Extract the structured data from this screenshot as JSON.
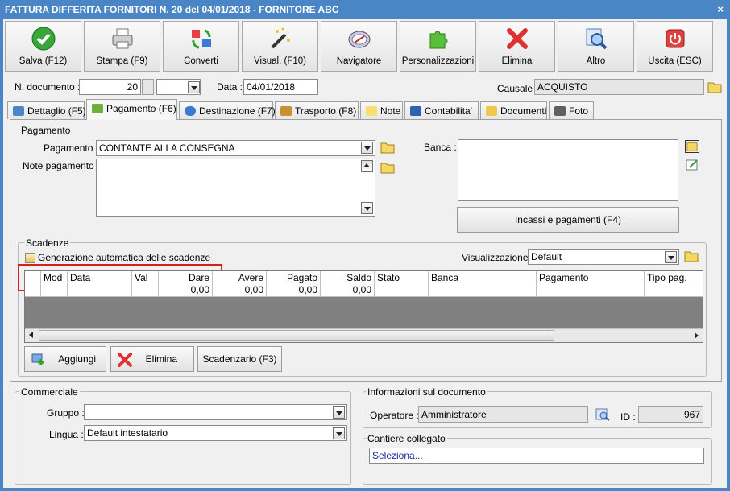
{
  "window": {
    "title": "FATTURA DIFFERITA FORNITORI N. 20 del 04/01/2018 - FORNITORE ABC",
    "close_glyph": "×"
  },
  "toolbar": [
    {
      "label": "Salva (F12)",
      "icon": "check-icon"
    },
    {
      "label": "Stampa (F9)",
      "icon": "printer-icon"
    },
    {
      "label": "Converti",
      "icon": "convert-icon"
    },
    {
      "label": "Visual. (F10)",
      "icon": "magic-wand-icon"
    },
    {
      "label": "Navigatore",
      "icon": "compass-icon"
    },
    {
      "label": "Personalizzazioni",
      "icon": "puzzle-icon"
    },
    {
      "label": "Elimina",
      "icon": "delete-x-icon"
    },
    {
      "label": "Altro",
      "icon": "magnifier-icon"
    },
    {
      "label": "Uscita (ESC)",
      "icon": "power-icon"
    }
  ],
  "header": {
    "doc_label": "N. documento :",
    "doc_number": "20",
    "doc_suffix": "",
    "date_label": "Data :",
    "date_value": "04/01/2018",
    "causale_label": "Causale :",
    "causale_value": "ACQUISTO"
  },
  "tabs": [
    {
      "label": "Dettaglio (F5)",
      "icon": "window-icon",
      "active": false
    },
    {
      "label": "Pagamento (F6)",
      "icon": "payment-icon",
      "active": true
    },
    {
      "label": "Destinazione (F7)",
      "icon": "globe-icon",
      "active": false
    },
    {
      "label": "Trasporto (F8)",
      "icon": "truck-icon",
      "active": false
    },
    {
      "label": "Note",
      "icon": "note-icon",
      "active": false
    },
    {
      "label": "Contabilita'",
      "icon": "book-icon",
      "active": false
    },
    {
      "label": "Documenti",
      "icon": "folder-icon",
      "active": false
    },
    {
      "label": "Foto",
      "icon": "camera-icon",
      "active": false
    }
  ],
  "pagamento": {
    "group_title": "Pagamento",
    "pagamento_label": "Pagamento :",
    "pagamento_value": "CONTANTE ALLA CONSEGNA",
    "note_label": "Note pagamento :",
    "note_value": "",
    "banca_label": "Banca :",
    "banca_value": "",
    "incassi_button": "Incassi e pagamenti (F4)"
  },
  "scadenze": {
    "group_title": "Scadenze",
    "auto_checkbox_label": "Generazione automatica delle scadenze",
    "auto_checked": false,
    "visual_label": "Visualizzazione :",
    "visual_value": "Default",
    "columns": [
      "Mod",
      "Data",
      "Val",
      "Dare",
      "Avere",
      "Pagato",
      "Saldo",
      "Stato",
      "Banca",
      "Pagamento",
      "Tipo pag."
    ],
    "totals": [
      "",
      "",
      "",
      "0,00",
      "0,00",
      "0,00",
      "0,00",
      "",
      "",
      "",
      ""
    ],
    "buttons": {
      "add": "Aggiungi",
      "delete": "Elimina",
      "scadenzario": "Scadenzario (F3)"
    }
  },
  "commerciale": {
    "group_title": "Commerciale",
    "gruppo_label": "Gruppo :",
    "gruppo_value": "",
    "lingua_label": "Lingua :",
    "lingua_value": "Default intestatario"
  },
  "info": {
    "group_title": "Informazioni sul documento",
    "operatore_label": "Operatore :",
    "operatore_value": "Amministratore",
    "id_label": "ID :",
    "id_value": "967"
  },
  "cantiere": {
    "group_title": "Cantiere collegato",
    "value": "Seleziona..."
  }
}
